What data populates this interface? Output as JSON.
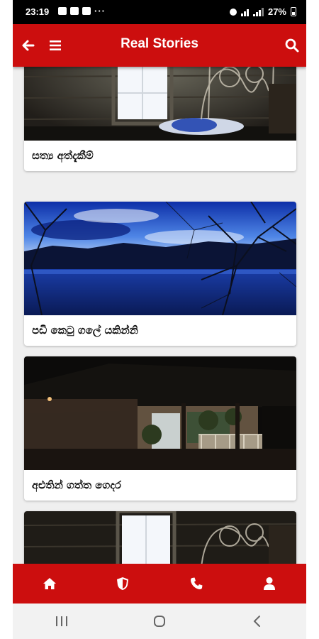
{
  "status_bar": {
    "time": "23:19",
    "battery": "27%",
    "more": "···"
  },
  "header": {
    "title": "Real Stories"
  },
  "stories": [
    {
      "title": "සත්‍ය අත්දැකීම්"
    },
    {
      "title": "පඩි කෙටු ගලේ යකින්නි"
    },
    {
      "title": "අළුතින් ගත්ත ගෙදර"
    },
    {
      "title": ""
    }
  ],
  "colors": {
    "primary": "#cc0e0e",
    "background": "#efefef"
  },
  "bottom_nav": {
    "items": [
      "home-icon",
      "shield-icon",
      "phone-icon",
      "user-icon"
    ]
  },
  "system_nav": {
    "items": [
      "recents-icon",
      "home-circle-icon",
      "back-chevron-icon"
    ]
  }
}
